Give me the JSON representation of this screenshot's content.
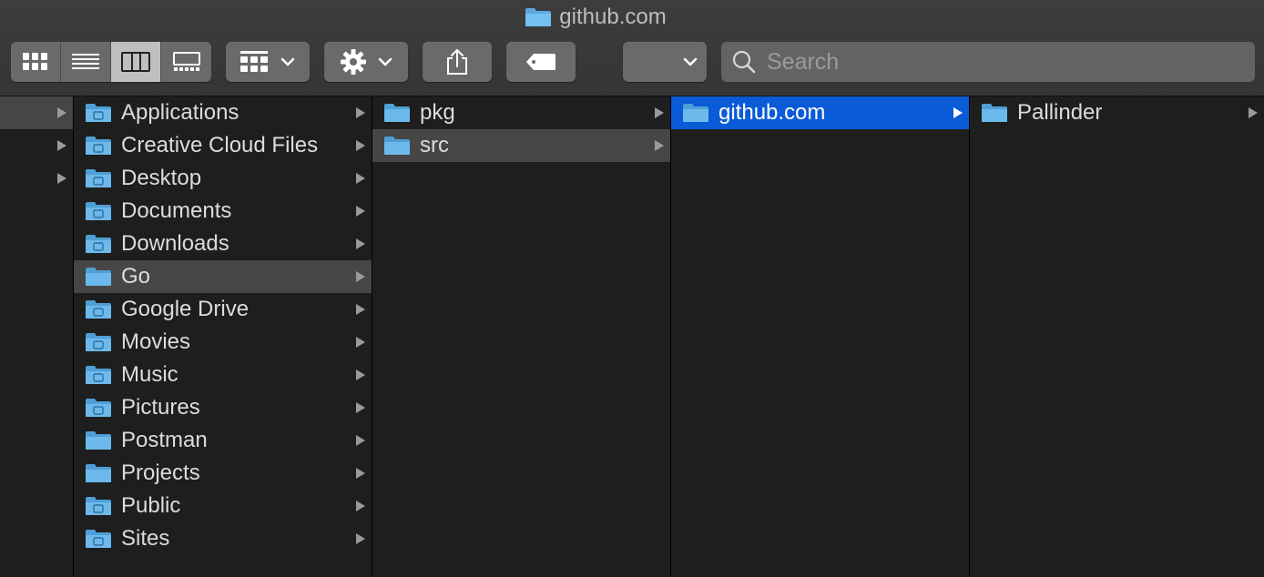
{
  "window": {
    "title": "github.com"
  },
  "toolbar": {
    "view_buttons": [
      "icon-view",
      "list-view",
      "column-view",
      "gallery-view"
    ],
    "active_view": "column-view",
    "group_button": "group-by",
    "action_button": "action",
    "share_button": "share",
    "tag_button": "tags",
    "path_dropdown": "",
    "search_placeholder": "Search"
  },
  "colors": {
    "selection": "#0a5bd7",
    "highlight": "#464646",
    "folder": "#6bb6e6",
    "background": "#1e1e1e"
  },
  "columns": {
    "home": {
      "items": [
        {
          "label": "Applications",
          "icon": "applications-folder-icon"
        },
        {
          "label": "Creative Cloud Files",
          "icon": "creative-cloud-folder-icon"
        },
        {
          "label": "Desktop",
          "icon": "desktop-folder-icon"
        },
        {
          "label": "Documents",
          "icon": "documents-folder-icon"
        },
        {
          "label": "Downloads",
          "icon": "downloads-folder-icon"
        },
        {
          "label": "Go",
          "icon": "folder-icon"
        },
        {
          "label": "Google Drive",
          "icon": "google-drive-folder-icon"
        },
        {
          "label": "Movies",
          "icon": "movies-folder-icon"
        },
        {
          "label": "Music",
          "icon": "music-folder-icon"
        },
        {
          "label": "Pictures",
          "icon": "pictures-folder-icon"
        },
        {
          "label": "Postman",
          "icon": "folder-icon"
        },
        {
          "label": "Projects",
          "icon": "folder-icon"
        },
        {
          "label": "Public",
          "icon": "public-folder-icon"
        },
        {
          "label": "Sites",
          "icon": "sites-folder-icon"
        }
      ]
    },
    "go": {
      "items": [
        {
          "label": "pkg",
          "icon": "folder-icon"
        },
        {
          "label": "src",
          "icon": "folder-icon"
        }
      ]
    },
    "src": {
      "items": [
        {
          "label": "github.com",
          "icon": "folder-icon"
        }
      ]
    },
    "github": {
      "items": [
        {
          "label": "Pallinder",
          "icon": "folder-icon"
        }
      ]
    }
  }
}
